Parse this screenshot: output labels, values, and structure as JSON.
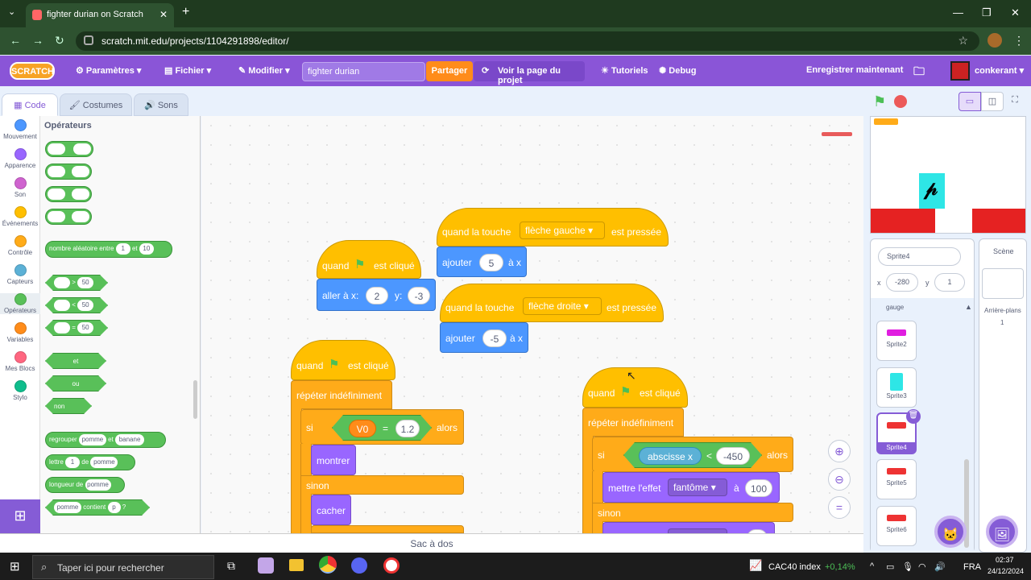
{
  "browser": {
    "tab_title": "fighter durian on Scratch",
    "url": "scratch.mit.edu/projects/1104291898/editor/"
  },
  "menubar": {
    "logo": "SCRATCH",
    "settings": "Paramètres",
    "file": "Fichier",
    "edit": "Modifier",
    "project_title": "fighter durian",
    "share": "Partager",
    "see_project": "Voir la page du projet",
    "tutorials": "Tutoriels",
    "debug": "Debug",
    "save_now": "Enregistrer maintenant",
    "username": "conkerant"
  },
  "tabs": {
    "code": "Code",
    "costumes": "Costumes",
    "sounds": "Sons"
  },
  "categories": [
    {
      "label": "Mouvement",
      "color": "#4c97ff"
    },
    {
      "label": "Apparence",
      "color": "#9966ff"
    },
    {
      "label": "Son",
      "color": "#cf63cf"
    },
    {
      "label": "Événements",
      "color": "#ffbf00"
    },
    {
      "label": "Contrôle",
      "color": "#ffab19"
    },
    {
      "label": "Capteurs",
      "color": "#5cb1d6"
    },
    {
      "label": "Opérateurs",
      "color": "#59c059"
    },
    {
      "label": "Variables",
      "color": "#ff8c1a"
    },
    {
      "label": "Mes Blocs",
      "color": "#ff6680"
    },
    {
      "label": "Stylo",
      "color": "#0fbd8c"
    }
  ],
  "palette": {
    "title": "Opérateurs",
    "random_label": "nombre aléatoire entre",
    "random_a": "1",
    "random_and": "et",
    "random_b": "10",
    "cmp_gt": ">",
    "cmp_lt": "<",
    "cmp_eq": "=",
    "cmp_val": "50",
    "and": "et",
    "or": "ou",
    "not": "non",
    "join_label": "regrouper",
    "join_a": "pomme",
    "join_and": "et",
    "join_b": "banane",
    "letter_label": "lettre",
    "letter_n": "1",
    "letter_of": "de",
    "letter_word": "pomme",
    "length_label": "longueur de",
    "length_word": "pomme",
    "contains_word": "pomme",
    "contains_label": "contient",
    "contains_letter": "p",
    "contains_q": "?"
  },
  "scripts": {
    "flag_hat": "quand",
    "flag_clicked": "est cliqué",
    "goto_label": "aller à x:",
    "goto_x": "2",
    "goto_y_label": "y:",
    "goto_y": "-3",
    "key_hat": "quand la touche",
    "key_left": "flèche gauche",
    "key_right": "flèche droite",
    "key_pressed": "est pressée",
    "change_x_label": "ajouter",
    "change_x_a": "5",
    "change_x_b": "-5",
    "change_x_suffix": "à x",
    "forever": "répéter indéfiniment",
    "if": "si",
    "then": "alors",
    "else": "sinon",
    "var_v0": "V0",
    "eq": "=",
    "eq_val": "1.2",
    "show": "montrer",
    "hide": "cacher",
    "x_position": "abscisse x",
    "lt": "<",
    "lt_val": "-450",
    "set_effect": "mettre l'effet",
    "ghost": "fantôme",
    "to": "à",
    "effect_a": "100",
    "effect_b": "0"
  },
  "sprite_info": {
    "name": "Sprite4",
    "x_label": "x",
    "x": "-280",
    "y_label": "y",
    "y": "1"
  },
  "sprites": [
    {
      "name": "gauge"
    },
    {
      "name": "Sprite2"
    },
    {
      "name": "Sprite3"
    },
    {
      "name": "Sprite4"
    },
    {
      "name": "Sprite5"
    },
    {
      "name": "Sprite6"
    }
  ],
  "stage_pane": {
    "title": "Scène",
    "backdrops_label": "Arrière-plans",
    "backdrops_count": "1"
  },
  "backpack": "Sac à dos",
  "taskbar": {
    "search_placeholder": "Taper ici pour rechercher",
    "stock_name": "CAC40 index",
    "stock_change": "+0,14%",
    "lang": "FRA",
    "time": "02:37",
    "date": "24/12/2024"
  }
}
